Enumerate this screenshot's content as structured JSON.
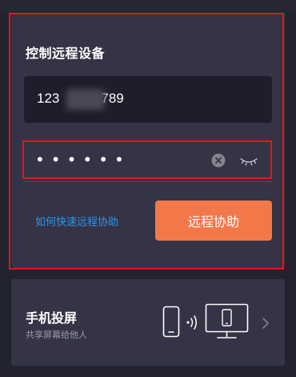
{
  "remote_control": {
    "title": "控制远程设备",
    "device_id_prefix": "123",
    "device_id_suffix": "789",
    "password_mask": "••••••",
    "help_link": "如何快速远程协助",
    "assist_button": "远程协助"
  },
  "screen_cast": {
    "title": "手机投屏",
    "subtitle": "共享屏幕给他人"
  },
  "icons": {
    "clear": "clear-circle-icon",
    "eye": "eye-closed-icon",
    "phone": "phone-icon",
    "waves": "wireless-waves-icon",
    "monitor": "monitor-icon",
    "chevron": "chevron-right-icon"
  },
  "colors": {
    "background": "#23232f",
    "card": "#343446",
    "input": "#1d1d2b",
    "accent_button": "#f2784a",
    "link": "#2c95ea",
    "highlight": "#e8141a"
  }
}
